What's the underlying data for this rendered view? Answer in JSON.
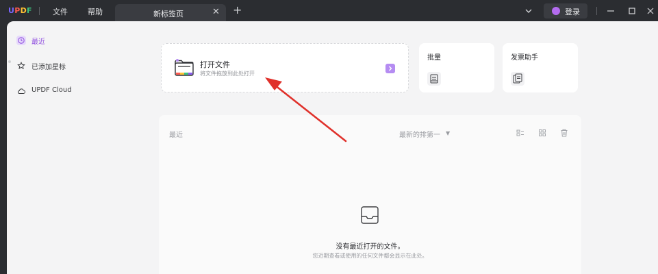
{
  "app": {
    "logo_letters": [
      "U",
      "P",
      "D",
      "F"
    ],
    "logo_colors": [
      "#7b66ff",
      "#ff5a4f",
      "#ffc233",
      "#3ec27e"
    ]
  },
  "menu": {
    "file": "文件",
    "help": "帮助"
  },
  "tab": {
    "title": "新标签页",
    "close_glyph": "✕",
    "add_glyph": "+"
  },
  "account": {
    "login_label": "登录"
  },
  "sidebar": {
    "items": [
      {
        "label": "最近",
        "icon": "clock-icon",
        "active": true
      },
      {
        "label": "已添加星标",
        "icon": "star-icon",
        "active": false
      },
      {
        "label": "UPDF Cloud",
        "icon": "cloud-icon",
        "active": false
      }
    ]
  },
  "open_card": {
    "title": "打开文件",
    "subtitle": "将文件拖放到此处打开",
    "icon": "folder-icon"
  },
  "cards": [
    {
      "title": "批量",
      "icon": "batch-icon"
    },
    {
      "title": "发票助手",
      "icon": "invoice-icon"
    }
  ],
  "recent": {
    "title": "最近",
    "sort_label": "最新的排第一",
    "empty_title": "没有最近打开的文件。",
    "empty_subtitle": "您近期查看或使用的任何文件都会显示在此处。"
  },
  "colors": {
    "accent": "#9354e0",
    "annotation_arrow": "#e0312b"
  }
}
